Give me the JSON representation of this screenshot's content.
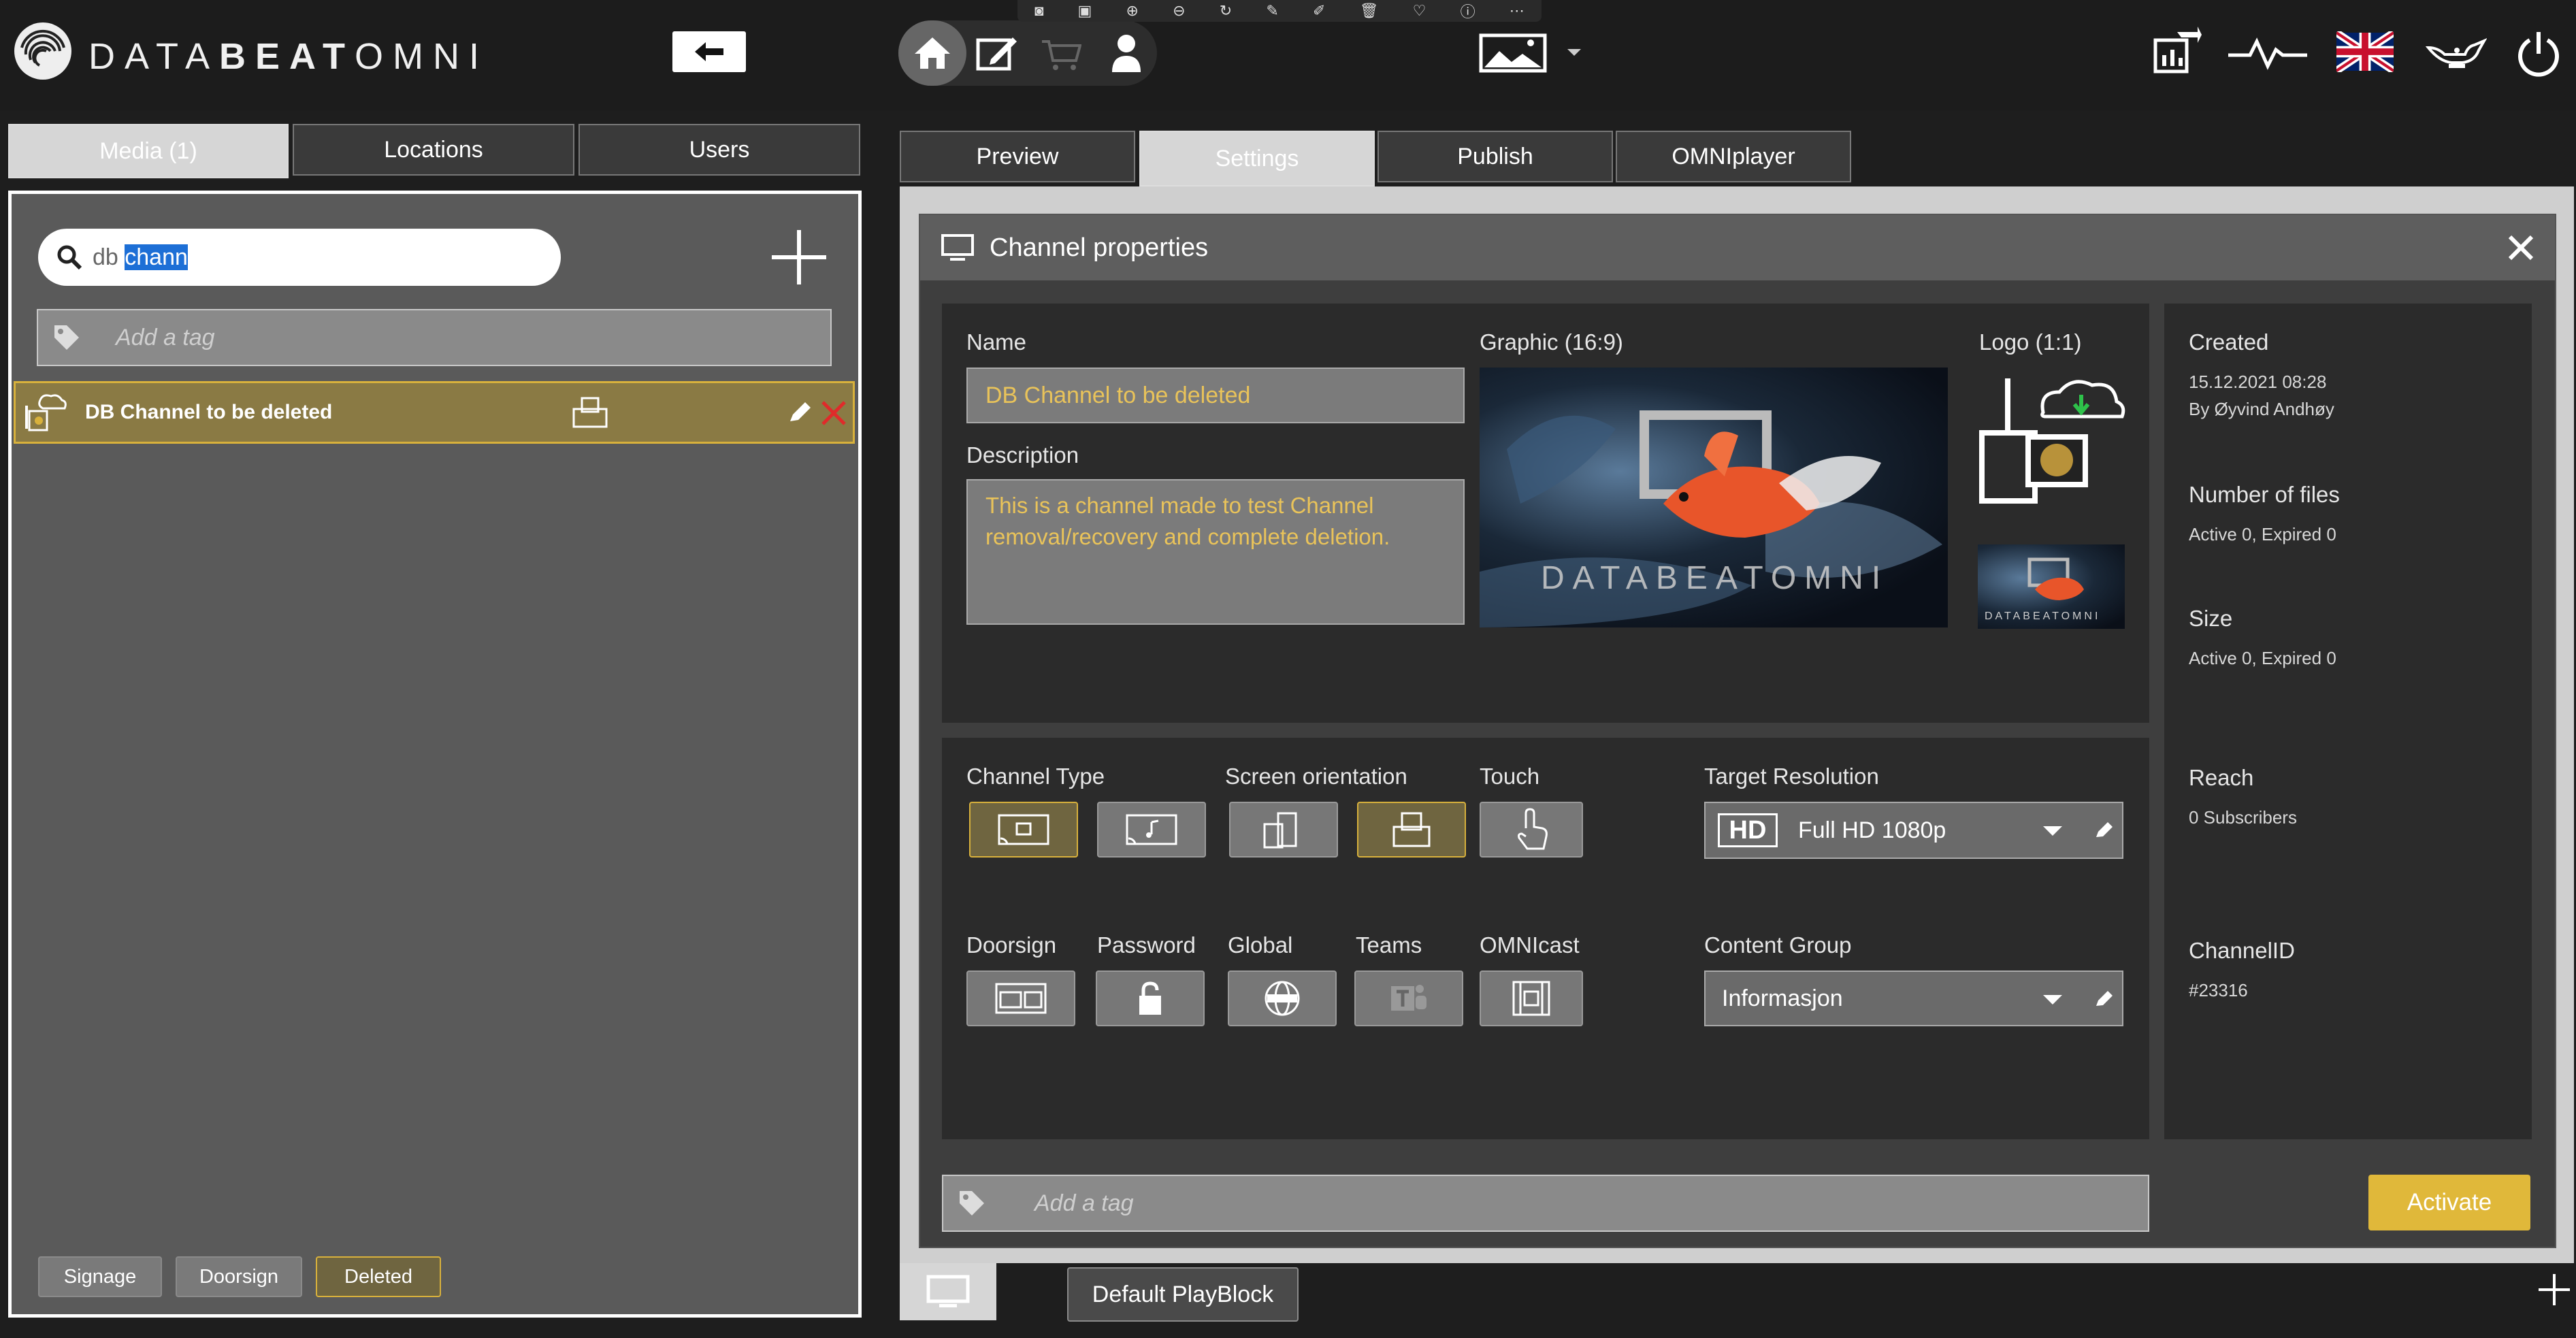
{
  "brand": {
    "prefix": "DATA",
    "bold": "BEAT",
    "suffix": "OMNI"
  },
  "toolbar_icons": [
    "camera-icon",
    "screenshot-icon",
    "zoom-in-icon",
    "zoom-out-icon",
    "rotate-icon",
    "edit-icon",
    "pen-icon",
    "delete-icon",
    "heart-icon",
    "info-icon",
    "more-icon"
  ],
  "left_tabs": [
    {
      "label": "Media (1)"
    },
    {
      "label": "Locations"
    },
    {
      "label": "Users"
    }
  ],
  "search": {
    "prefix": "db ",
    "selected": "chann"
  },
  "tag_placeholder": "Add a tag",
  "media_item": {
    "name": "DB Channel to be deleted"
  },
  "filters": [
    {
      "label": "Signage"
    },
    {
      "label": "Doorsign"
    },
    {
      "label": "Deleted"
    }
  ],
  "right_tabs": [
    {
      "label": "Preview"
    },
    {
      "label": "Settings"
    },
    {
      "label": "Publish"
    },
    {
      "label": "OMNIplayer"
    }
  ],
  "panel": {
    "title": "Channel properties"
  },
  "form": {
    "name_label": "Name",
    "name_value": "DB Channel to be deleted",
    "description_label": "Description",
    "description_value": "This is a channel made to test Channel removal/recovery and complete deletion.",
    "graphic_label": "Graphic (16:9)",
    "logo_label": "Logo (1:1)",
    "graphic_watermark": "DATABEATOMNI",
    "channel_type_label": "Channel Type",
    "orientation_label": "Screen orientation",
    "touch_label": "Touch",
    "resolution_label": "Target Resolution",
    "resolution_badge": "HD",
    "resolution_value": "Full HD 1080p",
    "doorsign_label": "Doorsign",
    "password_label": "Password",
    "global_label": "Global",
    "teams_label": "Teams",
    "omnicast_label": "OMNIcast",
    "content_group_label": "Content Group",
    "content_group_value": "Informasjon"
  },
  "info": {
    "created_label": "Created",
    "created_date": "15.12.2021 08:28",
    "created_by": "By Øyvind Andhøy",
    "files_label": "Number of files",
    "files_value": "Active 0, Expired 0",
    "size_label": "Size",
    "size_value": "Active 0, Expired 0",
    "reach_label": "Reach",
    "reach_value": "0 Subscribers",
    "channelid_label": "ChannelID",
    "channelid_value": "#23316"
  },
  "activate_label": "Activate",
  "playblock_label": "Default PlayBlock",
  "colors": {
    "accent": "#e0b83a",
    "selected_bg": "#6f6540",
    "panel": "#2b2b2b",
    "card": "#565656"
  }
}
